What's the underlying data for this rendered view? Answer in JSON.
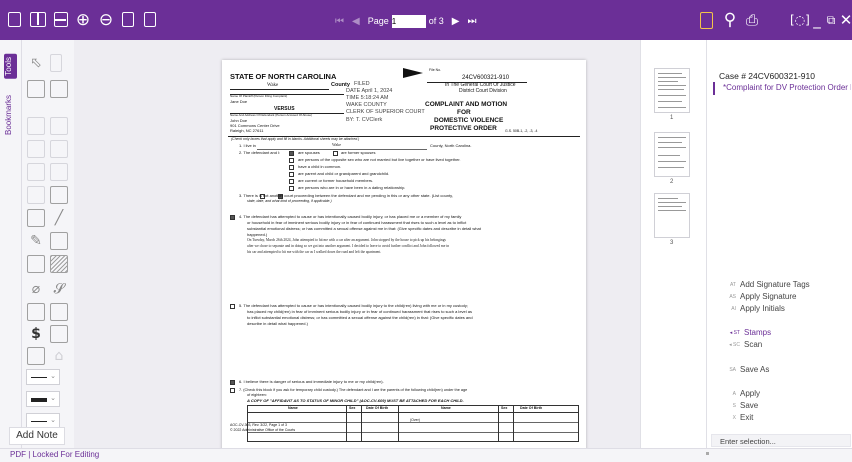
{
  "pager": {
    "page_label": "Page",
    "page_value": "1",
    "page_of": "of 3"
  },
  "tabs": {
    "tools": "Tools",
    "bookmarks": "Bookmarks"
  },
  "add_note": "Add Note",
  "status": "PDF | Locked For Editing",
  "document": {
    "state": "STATE OF NORTH CAROLINA",
    "county_value": "Wake",
    "county_label": "County",
    "file_no_label": "File No.",
    "file_no": "24CV600321-910",
    "court_line1": "In The General Court Of Justice",
    "court_line2": "District Court Division",
    "filed_stamp": [
      "FILED",
      "DATE April 1, 2024",
      "TIME 5:18:24 AM",
      "WAKE COUNTY",
      "CLERK OF SUPERIOR COURT",
      "BY: T. CVClerk"
    ],
    "plaintiff_label": "Name Of Plaintiff (Person Filing Complaint)",
    "plaintiff_name": "Jane Doe",
    "versus": "VERSUS",
    "defendant_label": "Name And Address Of Defendant (Person Accused Of Abuse)",
    "defendant_lines": [
      "John Doe",
      "901 Commons Center Drive",
      "Raleigh, NC 27611"
    ],
    "title_lines": [
      "COMPLAINT AND MOTION",
      "FOR",
      "DOMESTIC VIOLENCE",
      "PROTECTIVE ORDER"
    ],
    "statute": "G.S. 50B-1, -2, -3, -4",
    "instruction": "(Check only boxes that apply and fill in blanks. Additional sheets may be attached.)",
    "item1_prefix": "1. I live in",
    "item1_value": "Wake",
    "item1_suffix": "County, North Carolina.",
    "item2_lead": "2. The defendant and I:",
    "item2_options": [
      "are spouses",
      "are former spouses",
      "are persons of the opposite sex who are not married but live together or have lived together.",
      "have a child in common.",
      "are parent and child or grandparent and grandchild.",
      "are current or former household members.",
      "are persons who are in or have been in a dating relationship."
    ],
    "item3_lines": [
      "3. There    is    is not   another court proceeding between the defendant and me pending in this or any other state. (List county,",
      "state, date, and what kind of proceeding, if applicable.)"
    ],
    "item4_lines": [
      "4. The defendant has attempted to cause or has intentionally caused bodily injury, or has placed me or a member of my family",
      "or household in fear of imminent serious bodily injury or in fear of continued harassment that rises to such a level as to inflict",
      "substantial emotional distress; or has committed a sexual offense against me in that: (Give specific dates and describe in detail what",
      "happened.)"
    ],
    "item4_narrative": [
      "On Tuesday, March 26th 2024, John attempted to hit me with a car after an argument. John stopped by the house to pick up his belongings",
      "after we chose to separate and in doing so we got into another argument. I decided to leave to avoid further conflict and John followed me in",
      "his car and attempted to hit me with the car as I walked down the road and left the apartment."
    ],
    "item5_lines": [
      "5. The defendant has attempted to cause or has intentionally caused bodily injury to the child(ren) living with me or in my custody;",
      "has placed my child(ren) in fear of imminent serious bodily injury or in fear of continued harassment that rises to such a level as",
      "to inflict substantial emotional distress; or has committed a sexual offense against the child(ren) in that: (Give specific dates and",
      "describe in detail what happened.)"
    ],
    "item6": "6. I believe there is danger of serious and immediate injury to me or my child(ren).",
    "item7_lines": [
      "7. (Check this block if you ask for temporary child custody.) The defendant and I are the parents of the following child(ren) under the age",
      "of eighteen:"
    ],
    "item7_note": "A COPY OF \"AFFIDAVIT AS TO STATUS OF MINOR CHILD\" (AOC-CV-609) MUST BE ATTACHED FOR EACH CHILD.",
    "table_headers": [
      "Name",
      "Sex",
      "Date Of Birth",
      "Name",
      "Sex",
      "Date Of Birth"
    ],
    "footer_left": [
      "AOC-CV-303, Rev. 3/22, Page 1 of 3",
      "© 2022 Administrative Office of the Courts"
    ],
    "footer_over": "(Over)"
  },
  "thumbnails": [
    "1",
    "2",
    "3"
  ],
  "right": {
    "case_number": "Case # 24CV600321-910",
    "bookmark": "*Complaint for DV Protection Order File..."
  },
  "actions": [
    {
      "abbr": "AT",
      "label": "Add Signature Tags"
    },
    {
      "abbr": "AS",
      "label": "Apply Signature"
    },
    {
      "abbr": "AI",
      "label": "Apply Initials"
    },
    {
      "abbr": "◂ ST",
      "label": "Stamps"
    },
    {
      "abbr": "◂ SC",
      "label": "Scan"
    },
    {
      "abbr": "SA",
      "label": "Save As"
    },
    {
      "abbr": "A",
      "label": "Apply"
    },
    {
      "abbr": "S",
      "label": "Save"
    },
    {
      "abbr": "X",
      "label": "Exit"
    }
  ],
  "enter_selection": "Enter selection...",
  "colors": {
    "brand": "#6b2f97",
    "background": "#eeedf2"
  },
  "icons": [
    "single-page-icon",
    "two-page-icon",
    "fit-page-icon",
    "zoom-in-icon",
    "zoom-out-icon",
    "rotate-icon",
    "crop-icon",
    "first-page-icon",
    "prev-page-icon",
    "next-page-icon",
    "last-page-icon",
    "document-view-icon",
    "search-icon",
    "print-icon",
    "focus-mode-icon",
    "minimize-icon",
    "restore-icon",
    "close-icon"
  ]
}
